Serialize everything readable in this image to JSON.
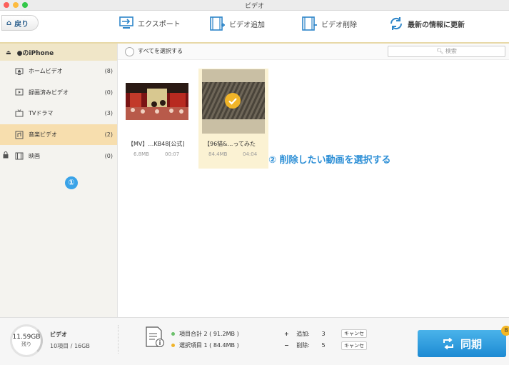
{
  "window": {
    "title": "ビデオ"
  },
  "toolbar": {
    "back_label": "戻り",
    "export_label": "エクスポート",
    "add_label": "ビデオ追加",
    "delete_label": "ビデオ削除",
    "refresh_label": "最新の情報に更新"
  },
  "sidebar": {
    "device_name": "●のiPhone",
    "items": [
      {
        "label": "ホームビデオ",
        "count": "(8)",
        "icon": "tv-home-icon"
      },
      {
        "label": "録画済みビデオ",
        "count": "(0)",
        "icon": "recorded-video-icon"
      },
      {
        "label": "TVドラマ",
        "count": "(3)",
        "icon": "tv-icon"
      },
      {
        "label": "音楽ビデオ",
        "count": "(2)",
        "icon": "music-video-icon",
        "active": true
      },
      {
        "label": "映画",
        "count": "(0)",
        "icon": "film-icon",
        "locked": true
      }
    ]
  },
  "main": {
    "select_all_label": "すべてを選択する",
    "search_placeholder": "検索",
    "videos": [
      {
        "title": "【MV】…KB48[公式]",
        "size": "6.8MB",
        "duration": "00:07",
        "selected": false
      },
      {
        "title": "【96猫&…ってみた",
        "size": "84.4MB",
        "duration": "04:04",
        "selected": true
      }
    ]
  },
  "annotations": {
    "step1": "①",
    "step2": "② 削除したい動画を選択する"
  },
  "footer": {
    "free_space": "11.59GB",
    "free_label": "残り",
    "category": "ビデオ",
    "category_info": "10項目 / 16GB",
    "total_items": "項目合計 2 ( 91.2MB )",
    "selected_items": "選択項目 1 ( 84.4MB )",
    "add_label": "追加:",
    "add_count": "3",
    "delete_label": "削除:",
    "delete_count": "5",
    "cancel_label": "キャンセ",
    "sync_label": "同期",
    "badge": "8"
  },
  "colors": {
    "accent": "#2d8fd6",
    "sidebar_active": "#f7deae",
    "selected_card": "#fbf2d3",
    "check": "#f0b429"
  }
}
